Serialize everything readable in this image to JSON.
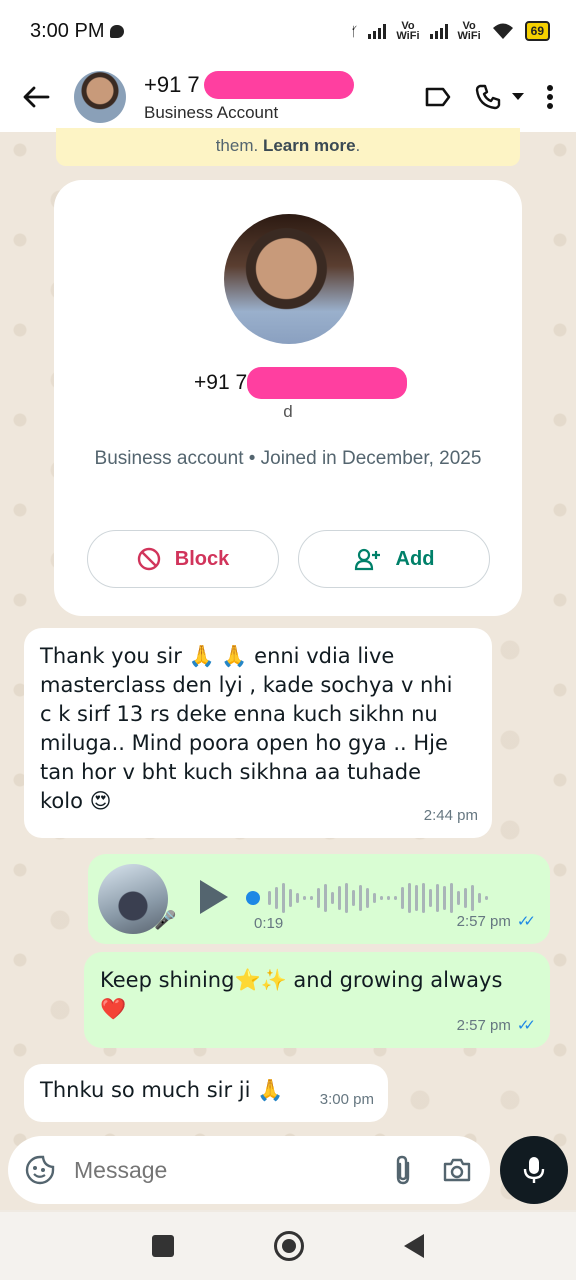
{
  "status_bar": {
    "time": "3:00 PM",
    "battery": "69",
    "vowifi_1": "Vo\nWiFi",
    "vowifi_2": "Vo\nWiFi"
  },
  "header": {
    "title": "+91 7",
    "subtitle": "Business Account"
  },
  "notice": {
    "text": "them. ",
    "link": "Learn more",
    "end": "."
  },
  "profile": {
    "phone": "+91 7",
    "suffix": "d",
    "info": "Business account • Joined in December, 2025",
    "block_label": "Block",
    "add_label": "Add"
  },
  "messages": [
    {
      "text": "Thank you sir 🙏 🙏 enni vdia live masterclass den lyi , kade sochya v nhi c k sirf 13 rs deke enna kuch sikhn nu miluga.. Mind poora open ho gya .. Hje tan hor v bht kuch sikhna aa tuhade kolo 😍",
      "time": "2:44 pm"
    },
    {
      "duration": "0:19",
      "time": "2:57 pm"
    },
    {
      "text": "Keep shining⭐✨ and growing always ❤️",
      "time": "2:57 pm"
    },
    {
      "text": "Thnku so much sir ji 🙏",
      "time": "3:00 pm"
    }
  ],
  "input": {
    "placeholder": "Message"
  },
  "colors": {
    "accent": "#008069",
    "block": "#d1345b",
    "outgoing_bubble": "#d9fdd3",
    "read_ticks": "#1e88e5"
  }
}
